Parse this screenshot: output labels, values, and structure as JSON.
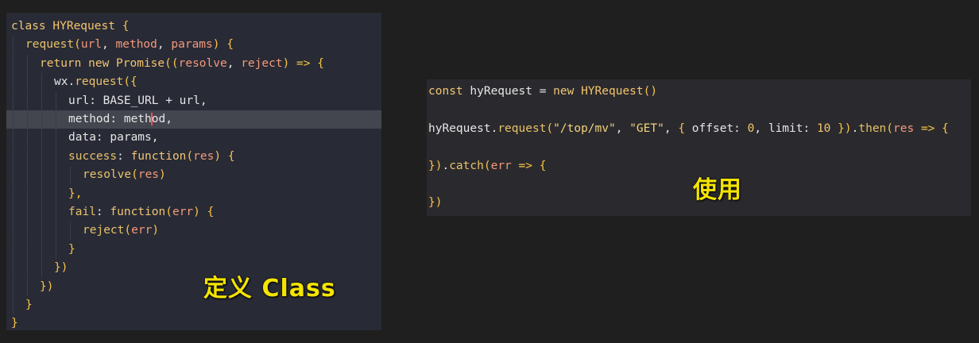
{
  "left_code": {
    "lines": [
      {
        "tokens": [
          {
            "t": "class ",
            "c": "k"
          },
          {
            "t": "HYRequest",
            "c": "cls"
          },
          {
            "t": " {",
            "c": "br"
          }
        ],
        "indent": 0
      },
      {
        "tokens": [
          {
            "t": "request",
            "c": "fn"
          },
          {
            "t": "(",
            "c": "br"
          },
          {
            "t": "url",
            "c": "v"
          },
          {
            "t": ", ",
            "c": "p"
          },
          {
            "t": "method",
            "c": "v"
          },
          {
            "t": ", ",
            "c": "p"
          },
          {
            "t": "params",
            "c": "v"
          },
          {
            "t": ") {",
            "c": "br"
          }
        ],
        "indent": 1
      },
      {
        "tokens": [
          {
            "t": "return ",
            "c": "k"
          },
          {
            "t": "new ",
            "c": "k"
          },
          {
            "t": "Promise",
            "c": "cls"
          },
          {
            "t": "((",
            "c": "br"
          },
          {
            "t": "resolve",
            "c": "v"
          },
          {
            "t": ", ",
            "c": "p"
          },
          {
            "t": "reject",
            "c": "v"
          },
          {
            "t": ") => {",
            "c": "br"
          }
        ],
        "indent": 2
      },
      {
        "tokens": [
          {
            "t": "wx.",
            "c": "p"
          },
          {
            "t": "request",
            "c": "fn"
          },
          {
            "t": "({",
            "c": "br"
          }
        ],
        "indent": 3
      },
      {
        "tokens": [
          {
            "t": "url: BASE_URL + url,",
            "c": "p"
          }
        ],
        "indent": 4
      },
      {
        "tokens": [
          {
            "t": "method: meth",
            "c": "p"
          },
          {
            "t": "|",
            "c": "cursor"
          },
          {
            "t": "od,",
            "c": "p"
          }
        ],
        "indent": 4,
        "highlight": true
      },
      {
        "tokens": [
          {
            "t": "data: params,",
            "c": "p"
          }
        ],
        "indent": 4
      },
      {
        "tokens": [
          {
            "t": "success",
            "c": "fn"
          },
          {
            "t": ": ",
            "c": "p"
          },
          {
            "t": "function",
            "c": "k"
          },
          {
            "t": "(",
            "c": "br"
          },
          {
            "t": "res",
            "c": "v"
          },
          {
            "t": ") {",
            "c": "br"
          }
        ],
        "indent": 4
      },
      {
        "tokens": [
          {
            "t": "resolve",
            "c": "fn"
          },
          {
            "t": "(",
            "c": "br"
          },
          {
            "t": "res",
            "c": "v"
          },
          {
            "t": ")",
            "c": "br"
          }
        ],
        "indent": 5
      },
      {
        "tokens": [
          {
            "t": "},",
            "c": "br"
          }
        ],
        "indent": 4
      },
      {
        "tokens": [
          {
            "t": "fail",
            "c": "fn"
          },
          {
            "t": ": ",
            "c": "p"
          },
          {
            "t": "function",
            "c": "k"
          },
          {
            "t": "(",
            "c": "br"
          },
          {
            "t": "err",
            "c": "v"
          },
          {
            "t": ") {",
            "c": "br"
          }
        ],
        "indent": 4
      },
      {
        "tokens": [
          {
            "t": "reject",
            "c": "fn"
          },
          {
            "t": "(",
            "c": "br"
          },
          {
            "t": "err",
            "c": "v"
          },
          {
            "t": ")",
            "c": "br"
          }
        ],
        "indent": 5
      },
      {
        "tokens": [
          {
            "t": "}",
            "c": "br"
          }
        ],
        "indent": 4
      },
      {
        "tokens": [
          {
            "t": "})",
            "c": "br"
          }
        ],
        "indent": 3
      },
      {
        "tokens": [
          {
            "t": "})",
            "c": "br"
          }
        ],
        "indent": 2
      },
      {
        "tokens": [
          {
            "t": "}",
            "c": "br"
          }
        ],
        "indent": 1
      },
      {
        "tokens": [
          {
            "t": "}",
            "c": "br"
          }
        ],
        "indent": 0
      }
    ]
  },
  "right_code": {
    "lines": [
      {
        "tokens": [
          {
            "t": "const ",
            "c": "k"
          },
          {
            "t": "hyRequest = ",
            "c": "p"
          },
          {
            "t": "new ",
            "c": "k"
          },
          {
            "t": "HYRequest",
            "c": "cls"
          },
          {
            "t": "()",
            "c": "br"
          }
        ]
      },
      {
        "tokens": []
      },
      {
        "tokens": [
          {
            "t": "hyRequest.",
            "c": "p"
          },
          {
            "t": "request",
            "c": "fn"
          },
          {
            "t": "(",
            "c": "br"
          },
          {
            "t": "\"/top/mv\"",
            "c": "s"
          },
          {
            "t": ", ",
            "c": "p"
          },
          {
            "t": "\"GET\"",
            "c": "s"
          },
          {
            "t": ", ",
            "c": "p"
          },
          {
            "t": "{ ",
            "c": "br"
          },
          {
            "t": "offset: ",
            "c": "p"
          },
          {
            "t": "0",
            "c": "n"
          },
          {
            "t": ", limit: ",
            "c": "p"
          },
          {
            "t": "10",
            "c": "n"
          },
          {
            "t": " })",
            "c": "br"
          },
          {
            "t": ".",
            "c": "p"
          },
          {
            "t": "then",
            "c": "fn"
          },
          {
            "t": "(",
            "c": "br"
          },
          {
            "t": "res",
            "c": "v"
          },
          {
            "t": " => {",
            "c": "br"
          }
        ]
      },
      {
        "tokens": []
      },
      {
        "tokens": [
          {
            "t": "})",
            "c": "br"
          },
          {
            "t": ".",
            "c": "p"
          },
          {
            "t": "catch",
            "c": "fn"
          },
          {
            "t": "(",
            "c": "br"
          },
          {
            "t": "err",
            "c": "v"
          },
          {
            "t": " => {",
            "c": "br"
          }
        ]
      },
      {
        "tokens": []
      },
      {
        "tokens": [
          {
            "t": "})",
            "c": "br"
          }
        ]
      }
    ]
  },
  "captions": {
    "left": "定义 Class",
    "right": "使用"
  }
}
